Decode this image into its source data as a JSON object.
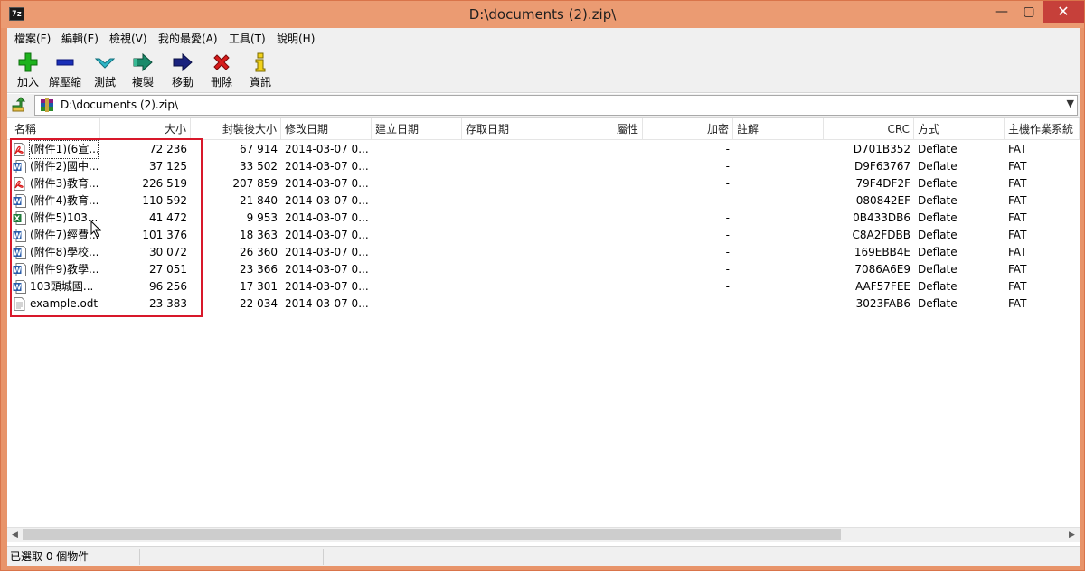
{
  "window": {
    "app_icon_text": "7z",
    "title": "D:\\documents (2).zip\\",
    "min_glyph": "—",
    "max_glyph": "▢",
    "close_glyph": "✕"
  },
  "menu": [
    "檔案(F)",
    "編輯(E)",
    "檢視(V)",
    "我的最愛(A)",
    "工具(T)",
    "說明(H)"
  ],
  "toolbar": [
    {
      "label": "加入",
      "icon": "plus-icon",
      "color": "#1db31d"
    },
    {
      "label": "解壓縮",
      "icon": "minus-icon",
      "color": "#1a2fb8"
    },
    {
      "label": "測試",
      "icon": "check-icon",
      "color": "#2fb6c8"
    },
    {
      "label": "複製",
      "icon": "copy-arrow-icon",
      "color": "#1a8a6a"
    },
    {
      "label": "移動",
      "icon": "move-arrow-icon",
      "color": "#1a237e"
    },
    {
      "label": "刪除",
      "icon": "delete-x-icon",
      "color": "#d81b1b"
    },
    {
      "label": "資訊",
      "icon": "info-icon",
      "color": "#e6c200"
    }
  ],
  "address": {
    "path": "D:\\documents (2).zip\\",
    "dropdown_glyph": "▼"
  },
  "columns": [
    "名稱",
    "大小",
    "封裝後大小",
    "修改日期",
    "建立日期",
    "存取日期",
    "屬性",
    "加密",
    "註解",
    "CRC",
    "方式",
    "主機作業系統"
  ],
  "files": [
    {
      "icon": "pdf-file-icon",
      "name": "(附件1)(6宣...",
      "size": "72 236",
      "packed": "67 914",
      "modified": "2014-03-07 0...",
      "encrypted": "-",
      "crc": "D701B352",
      "method": "Deflate",
      "host": "FAT"
    },
    {
      "icon": "word-file-icon",
      "name": "(附件2)國中...",
      "size": "37 125",
      "packed": "33 502",
      "modified": "2014-03-07 0...",
      "encrypted": "-",
      "crc": "D9F63767",
      "method": "Deflate",
      "host": "FAT"
    },
    {
      "icon": "pdf-file-icon",
      "name": "(附件3)教育...",
      "size": "226 519",
      "packed": "207 859",
      "modified": "2014-03-07 0...",
      "encrypted": "-",
      "crc": "79F4DF2F",
      "method": "Deflate",
      "host": "FAT"
    },
    {
      "icon": "word-file-icon",
      "name": "(附件4)教育...",
      "size": "110 592",
      "packed": "21 840",
      "modified": "2014-03-07 0...",
      "encrypted": "-",
      "crc": "080842EF",
      "method": "Deflate",
      "host": "FAT"
    },
    {
      "icon": "excel-file-icon",
      "name": "(附件5)103...",
      "size": "41 472",
      "packed": "9 953",
      "modified": "2014-03-07 0...",
      "encrypted": "-",
      "crc": "0B433DB6",
      "method": "Deflate",
      "host": "FAT"
    },
    {
      "icon": "word-file-icon",
      "name": "(附件7)經費...",
      "size": "101 376",
      "packed": "18 363",
      "modified": "2014-03-07 0...",
      "encrypted": "-",
      "crc": "C8A2FDBB",
      "method": "Deflate",
      "host": "FAT"
    },
    {
      "icon": "word-file-icon",
      "name": "(附件8)學校...",
      "size": "30 072",
      "packed": "26 360",
      "modified": "2014-03-07 0...",
      "encrypted": "-",
      "crc": "169EBB4E",
      "method": "Deflate",
      "host": "FAT"
    },
    {
      "icon": "word-file-icon",
      "name": "(附件9)教學...",
      "size": "27 051",
      "packed": "23 366",
      "modified": "2014-03-07 0...",
      "encrypted": "-",
      "crc": "7086A6E9",
      "method": "Deflate",
      "host": "FAT"
    },
    {
      "icon": "word-file-icon",
      "name": "103頭城國...",
      "size": "96 256",
      "packed": "17 301",
      "modified": "2014-03-07 0...",
      "encrypted": "-",
      "crc": "AAF57FEE",
      "method": "Deflate",
      "host": "FAT"
    },
    {
      "icon": "text-file-icon",
      "name": "example.odt",
      "size": "23 383",
      "packed": "22 034",
      "modified": "2014-03-07 0...",
      "encrypted": "-",
      "crc": "3023FAB6",
      "method": "Deflate",
      "host": "FAT"
    }
  ],
  "scrollbar": {
    "left_glyph": "◀",
    "right_glyph": "▶"
  },
  "status": {
    "selected": "已選取 0 個物件"
  },
  "colors": {
    "window_frame": "#e8946a",
    "close_button": "#c6403a",
    "highlight_box": "#d8182a"
  }
}
